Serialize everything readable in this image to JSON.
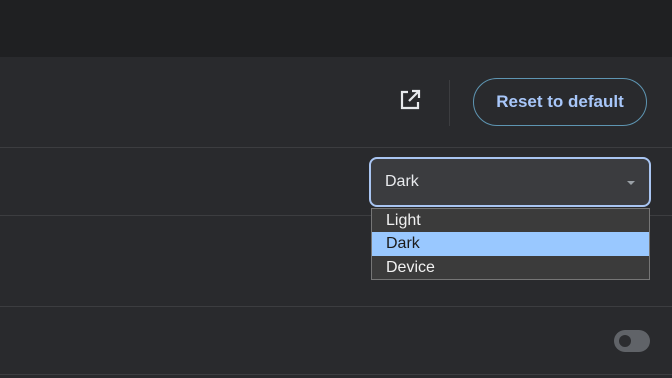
{
  "header": {
    "open_icon": "open-in-new-icon",
    "reset_label": "Reset to default"
  },
  "theme": {
    "selected_value": "Dark",
    "options": [
      "Light",
      "Dark",
      "Device"
    ],
    "highlighted_option": "Dark"
  },
  "toggle": {
    "state": "off"
  },
  "colors": {
    "accent": "#a8c7fa",
    "highlight": "#99c8ff",
    "background": "#292a2d"
  }
}
